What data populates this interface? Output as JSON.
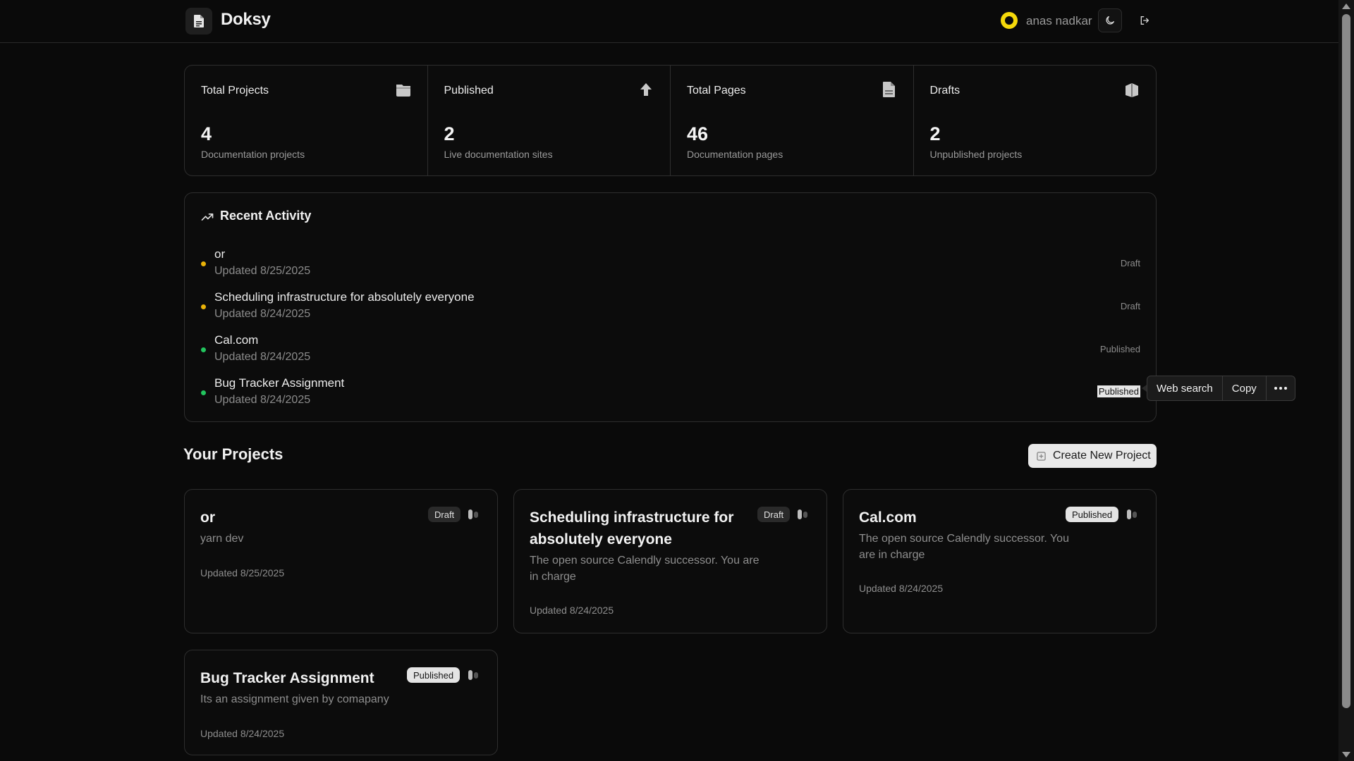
{
  "app": {
    "title": "Doksy"
  },
  "user": {
    "name": "anas nadkar"
  },
  "stats": [
    {
      "label": "Total Projects",
      "value": "4",
      "sub": "Documentation projects",
      "icon": "folder-icon"
    },
    {
      "label": "Published",
      "value": "2",
      "sub": "Live documentation sites",
      "icon": "upload-icon"
    },
    {
      "label": "Total Pages",
      "value": "46",
      "sub": "Documentation pages",
      "icon": "file-icon"
    },
    {
      "label": "Drafts",
      "value": "2",
      "sub": "Unpublished projects",
      "icon": "archive-icon"
    }
  ],
  "activity": {
    "title": "Recent Activity",
    "items": [
      {
        "name": "or",
        "date": "Updated 8/25/2025",
        "status": "Draft",
        "dot_color": "#eab308"
      },
      {
        "name": "Scheduling infrastructure for absolutely everyone",
        "date": "Updated 8/24/2025",
        "status": "Draft",
        "dot_color": "#eab308"
      },
      {
        "name": "Cal.com",
        "date": "Updated 8/24/2025",
        "status": "Published",
        "dot_color": "#22c55e"
      },
      {
        "name": "Bug Tracker Assignment",
        "date": "Updated 8/24/2025",
        "status": "Published",
        "dot_color": "#22c55e"
      }
    ]
  },
  "context_menu": {
    "web_search": "Web search",
    "copy": "Copy",
    "more": "···"
  },
  "projects": {
    "title": "Your Projects",
    "create_label": "Create New Project",
    "items": [
      {
        "title": "or",
        "desc": "yarn dev",
        "date": "Updated 8/25/2025",
        "status": "Draft"
      },
      {
        "title": "Scheduling infrastructure for absolutely everyone",
        "desc": "The open source Calendly successor. You are in charge",
        "date": "Updated 8/24/2025",
        "status": "Draft"
      },
      {
        "title": "Cal.com",
        "desc": "The open source Calendly successor. You are in charge",
        "date": "Updated 8/24/2025",
        "status": "Published"
      },
      {
        "title": "Bug Tracker Assignment",
        "desc": "Its an assignment given by comapany",
        "date": "Updated 8/24/2025",
        "status": "Published"
      }
    ]
  }
}
